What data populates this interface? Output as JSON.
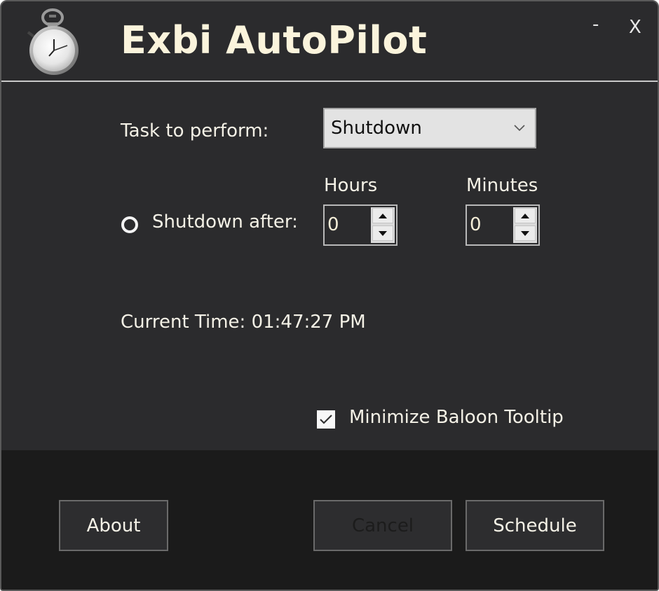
{
  "window": {
    "title": "Exbi AutoPilot",
    "app_icon": "stopwatch-icon",
    "minimize_label": "-",
    "close_label": "X"
  },
  "task": {
    "label": "Task to perform:",
    "selected": "Shutdown"
  },
  "schedule": {
    "hours_label": "Hours",
    "minutes_label": "Minutes",
    "radio_label": "Shutdown after:",
    "radio_checked": false,
    "hours_value": "0",
    "minutes_value": "0"
  },
  "status": {
    "current_time": "Current Time: 01:47:27 PM"
  },
  "options": {
    "minimize_tooltip_label": "Minimize Baloon Tooltip",
    "minimize_tooltip_checked": true
  },
  "buttons": {
    "about": "About",
    "cancel": "Cancel",
    "schedule": "Schedule"
  }
}
